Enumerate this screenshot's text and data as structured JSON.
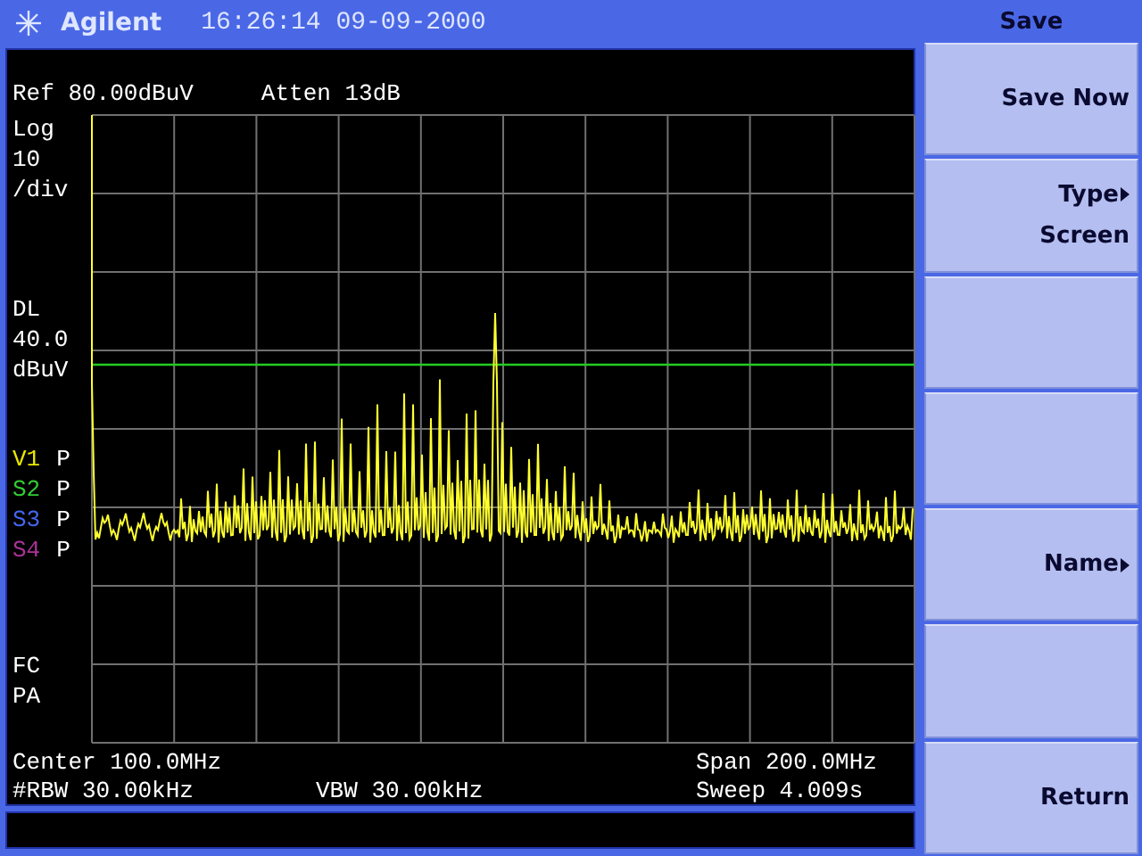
{
  "header": {
    "brand": "Agilent",
    "datetime": "16:26:14 09-09-2000",
    "menu_title": "Save"
  },
  "screen": {
    "ref_level": "Ref 80.00dBuV",
    "attenuation": "Atten 13dB",
    "scale": [
      "Log",
      "10",
      "/div"
    ],
    "display_line": [
      "DL",
      "40.0",
      "dBuV"
    ],
    "traces": [
      {
        "name": "V1",
        "mode": "P",
        "color": "#e8e800"
      },
      {
        "name": "S2",
        "mode": "P",
        "color": "#33cc33"
      },
      {
        "name": "S3",
        "mode": "P",
        "color": "#4466ee"
      },
      {
        "name": "S4",
        "mode": "P",
        "color": "#aa3399"
      }
    ],
    "flags": [
      "FC",
      "PA"
    ],
    "center": "Center 100.0MHz",
    "span": "Span 200.0MHz",
    "rbw": "#RBW 30.00kHz",
    "vbw": "VBW 30.00kHz",
    "sweep": "Sweep 4.009s"
  },
  "softkeys": [
    {
      "label": "Save Now",
      "submenu": false
    },
    {
      "label": "Type",
      "value": "Screen",
      "submenu": true
    },
    {
      "submenu": false
    },
    {
      "submenu": false
    },
    {
      "label": "Name",
      "submenu": true
    },
    {
      "submenu": false
    },
    {
      "label": "Return",
      "submenu": false
    }
  ]
}
